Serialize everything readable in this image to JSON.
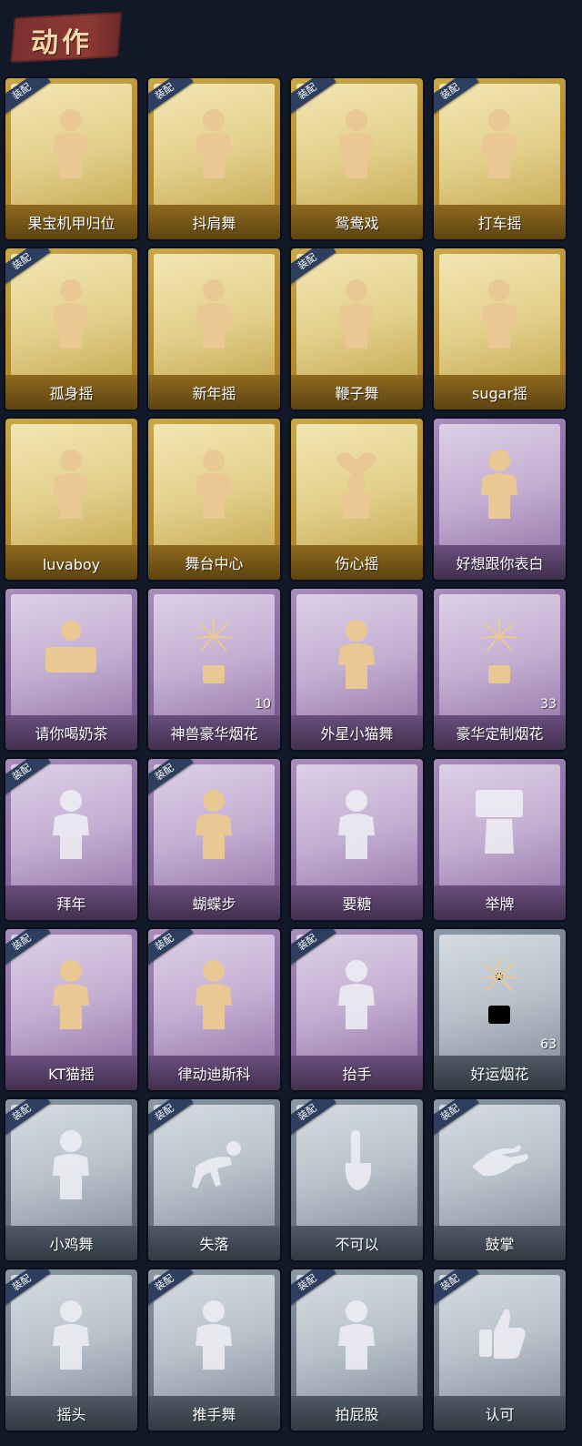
{
  "header": {
    "title": "动作"
  },
  "badge_text": "装配",
  "colors": {
    "gold": "#b88d2e",
    "purple": "#8a6aa3",
    "gray": "#6c7886",
    "badge": "#2d3e5e"
  },
  "items": [
    {
      "label": "果宝机甲归位",
      "rarity": "gold",
      "equipped": true,
      "icon": "pose-figure-icon"
    },
    {
      "label": "抖肩舞",
      "rarity": "gold",
      "equipped": true,
      "icon": "pose-figure-icon"
    },
    {
      "label": "鸳鸯戏",
      "rarity": "gold",
      "equipped": true,
      "icon": "pose-figure-icon"
    },
    {
      "label": "打车摇",
      "rarity": "gold",
      "equipped": true,
      "icon": "pose-figure-icon"
    },
    {
      "label": "孤身摇",
      "rarity": "gold",
      "equipped": true,
      "icon": "pose-figure-icon"
    },
    {
      "label": "新年摇",
      "rarity": "gold",
      "equipped": false,
      "icon": "pose-figure-icon"
    },
    {
      "label": "鞭子舞",
      "rarity": "gold",
      "equipped": true,
      "icon": "pose-figure-icon"
    },
    {
      "label": "sugar摇",
      "rarity": "gold",
      "equipped": false,
      "icon": "pose-figure-icon"
    },
    {
      "label": "luvaboy",
      "rarity": "gold",
      "equipped": false,
      "icon": "pose-figure-icon"
    },
    {
      "label": "舞台中心",
      "rarity": "gold",
      "equipped": false,
      "icon": "pose-figure-icon"
    },
    {
      "label": "伤心摇",
      "rarity": "gold",
      "equipped": false,
      "icon": "heart-pose-icon"
    },
    {
      "label": "好想跟你表白",
      "rarity": "purple",
      "equipped": false,
      "icon": "pose-figure-icon"
    },
    {
      "label": "请你喝奶茶",
      "rarity": "purple",
      "equipped": false,
      "icon": "banner-pose-icon"
    },
    {
      "label": "神兽豪华烟花",
      "rarity": "purple",
      "equipped": false,
      "icon": "firework-icon",
      "count": "10"
    },
    {
      "label": "外星小猫舞",
      "rarity": "purple",
      "equipped": false,
      "icon": "pose-figure-icon"
    },
    {
      "label": "豪华定制烟花",
      "rarity": "purple",
      "equipped": false,
      "icon": "firework-icon",
      "count": "33"
    },
    {
      "label": "拜年",
      "rarity": "purple",
      "equipped": true,
      "icon": "pose-figure-icon",
      "dim": true
    },
    {
      "label": "蝴蝶步",
      "rarity": "purple",
      "equipped": true,
      "icon": "pose-figure-icon"
    },
    {
      "label": "要糖",
      "rarity": "purple",
      "equipped": false,
      "icon": "pose-figure-icon",
      "dim": true
    },
    {
      "label": "举牌",
      "rarity": "purple",
      "equipped": false,
      "icon": "sign-pose-icon",
      "dim": true
    },
    {
      "label": "KT猫摇",
      "rarity": "purple",
      "equipped": true,
      "icon": "pose-figure-icon"
    },
    {
      "label": "律动迪斯科",
      "rarity": "purple",
      "equipped": true,
      "icon": "pose-figure-icon"
    },
    {
      "label": "抬手",
      "rarity": "purple",
      "equipped": true,
      "icon": "pose-figure-icon",
      "dim": true
    },
    {
      "label": "好运烟花",
      "rarity": "gray",
      "equipped": false,
      "icon": "firework-icon",
      "count": "63"
    },
    {
      "label": "小鸡舞",
      "rarity": "gray",
      "equipped": true,
      "icon": "pose-figure-icon",
      "dim": true
    },
    {
      "label": "失落",
      "rarity": "gray",
      "equipped": true,
      "icon": "crawl-pose-icon",
      "dim": true
    },
    {
      "label": "不可以",
      "rarity": "gray",
      "equipped": true,
      "icon": "finger-icon",
      "dim": true
    },
    {
      "label": "鼓掌",
      "rarity": "gray",
      "equipped": true,
      "icon": "clap-hands-icon",
      "dim": true
    },
    {
      "label": "摇头",
      "rarity": "gray",
      "equipped": true,
      "icon": "pose-figure-icon",
      "dim": true
    },
    {
      "label": "推手舞",
      "rarity": "gray",
      "equipped": true,
      "icon": "pose-figure-icon",
      "dim": true
    },
    {
      "label": "拍屁股",
      "rarity": "gray",
      "equipped": true,
      "icon": "pose-figure-icon",
      "dim": true
    },
    {
      "label": "认可",
      "rarity": "gray",
      "equipped": true,
      "icon": "thumbs-up-icon",
      "dim": true
    }
  ]
}
